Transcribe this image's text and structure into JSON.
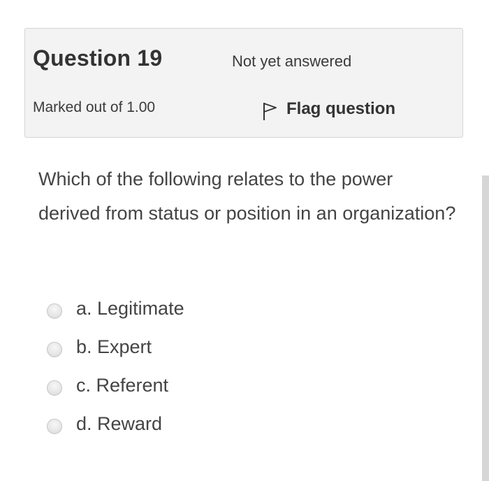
{
  "info": {
    "question_number": "Question 19",
    "state": "Not yet answered",
    "grade": "Marked out of 1.00",
    "flag_label": "Flag question",
    "flag_icon": "flag-icon"
  },
  "question": {
    "text": "Which of the following relates to the power derived from status or position in an organization?"
  },
  "answers": [
    {
      "label": "a. Legitimate",
      "selected": false
    },
    {
      "label": "b. Expert",
      "selected": false
    },
    {
      "label": "c. Referent",
      "selected": false
    },
    {
      "label": "d. Reward",
      "selected": false
    }
  ],
  "colors": {
    "info_background": "#f3f3f3",
    "info_border": "#d4d4d4",
    "text": "#444444",
    "scrollbar": "#d6d6d6"
  }
}
